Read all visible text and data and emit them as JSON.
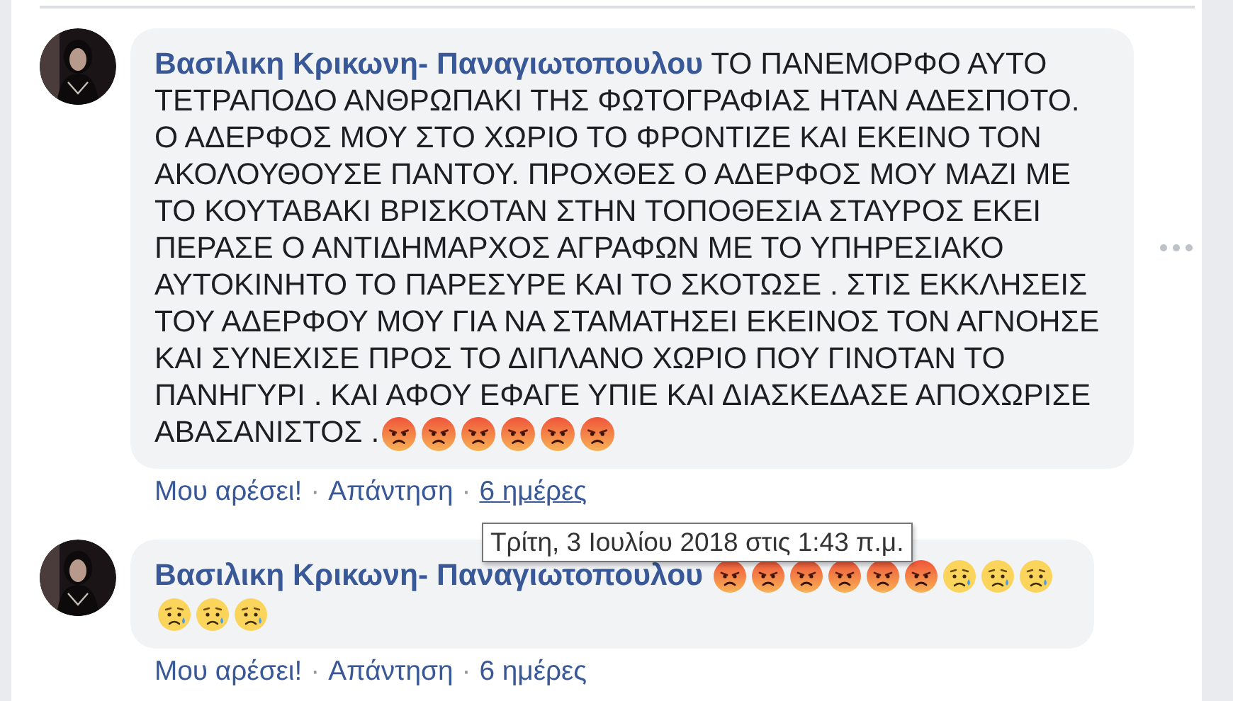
{
  "comments": [
    {
      "author": "Βασιλικη Κρικωνη- Παναγιωτοπουλου",
      "text": "ΤΟ ΠΑΝΕΜΟΡΦΟ ΑΥΤΟ ΤΕΤΡΑΠΟΔΟ ΑΝΘΡΩΠΑΚΙ ΤΗΣ ΦΩΤΟΓΡΑΦΙΑΣ ΗΤΑΝ ΑΔΕΣΠΟΤΟ. Ο ΑΔΕΡΦΟΣ ΜΟΥ ΣΤΟ ΧΩΡΙΟ ΤΟ ΦΡΟΝΤΙΖΕ ΚΑΙ ΕΚΕΙΝΟ ΤΟΝ ΑΚΟΛΟΥΘΟΥΣΕ ΠΑΝΤΟΥ. ΠΡΟΧΘΕΣ Ο ΑΔΕΡΦΟΣ ΜΟΥ ΜΑΖΙ ΜΕ ΤΟ ΚΟΥΤΑΒΑΚΙ ΒΡΙΣΚΟΤΑΝ ΣΤΗΝ ΤΟΠΟΘΕΣΙΑ ΣΤΑΥΡΟΣ ΕΚΕΙ ΠΕΡΑΣΕ Ο ΑΝΤΙΔΗΜΑΡΧΟΣ ΑΓΡΑΦΩΝ ΜΕ ΤΟ ΥΠΗΡΕΣΙΑΚΟ ΑΥΤΟΚΙΝΗΤΟ ΤΟ ΠΑΡΕΣΥΡΕ ΚΑΙ ΤΟ ΣΚΟΤΩΣΕ . ΣΤΙΣ ΕΚΚΛΗΣΕΙΣ ΤΟΥ ΑΔΕΡΦΟΥ ΜΟΥ ΓΙΑ ΝΑ ΣΤΑΜΑΤΗΣΕΙ ΕΚΕΙΝΟΣ ΤΟΝ ΑΓΝΟΗΣΕ ΚΑΙ ΣΥΝΕΧΙΣΕ ΠΡΟΣ ΤΟ ΔΙΠΛΑΝΟ ΧΩΡΙΟ ΠΟΥ ΓΙΝΟΤΑΝ ΤΟ ΠΑΝΗΓΥΡΙ . ΚΑΙ ΑΦΟΥ ΕΦΑΓΕ ΥΠΙΕ ΚΑΙ ΔΙΑΣΚΕΔΑΣΕ ΑΠΟΧΩΡΙΣΕ ΑΒΑΣΑΝΙΣΤΟΣ .",
      "emojis": [
        {
          "kind": "angry"
        },
        {
          "kind": "angry"
        },
        {
          "kind": "angry"
        },
        {
          "kind": "angry"
        },
        {
          "kind": "angry"
        },
        {
          "kind": "angry"
        }
      ],
      "more_menu": true,
      "actions": [
        {
          "kind": "link",
          "label": "Μου αρέσει!"
        },
        {
          "kind": "separator",
          "label": "·"
        },
        {
          "kind": "link",
          "label": "Απάντηση"
        },
        {
          "kind": "separator",
          "label": "·"
        },
        {
          "kind": "time",
          "label": "6 ημέρες",
          "hovered": true
        }
      ]
    },
    {
      "author": "Βασιλικη Κρικωνη- Παναγιωτοπουλου",
      "emojis": [
        {
          "kind": "angry"
        },
        {
          "kind": "angry"
        },
        {
          "kind": "angry"
        },
        {
          "kind": "angry"
        },
        {
          "kind": "angry"
        },
        {
          "kind": "angry"
        },
        {
          "kind": "sad"
        },
        {
          "kind": "sad"
        },
        {
          "kind": "sad"
        },
        {
          "kind": "sad"
        },
        {
          "kind": "sad"
        },
        {
          "kind": "sad"
        }
      ],
      "more_menu": false,
      "actions": [
        {
          "kind": "link",
          "label": "Μου αρέσει!"
        },
        {
          "kind": "separator",
          "label": "·"
        },
        {
          "kind": "link",
          "label": "Απάντηση"
        },
        {
          "kind": "separator",
          "label": "·"
        },
        {
          "kind": "time",
          "label": "6 ημέρες",
          "hovered": false
        }
      ]
    }
  ],
  "tooltip": {
    "text": "Τρίτη, 3 Ιουλίου 2018 στις 1:43 π.μ."
  }
}
